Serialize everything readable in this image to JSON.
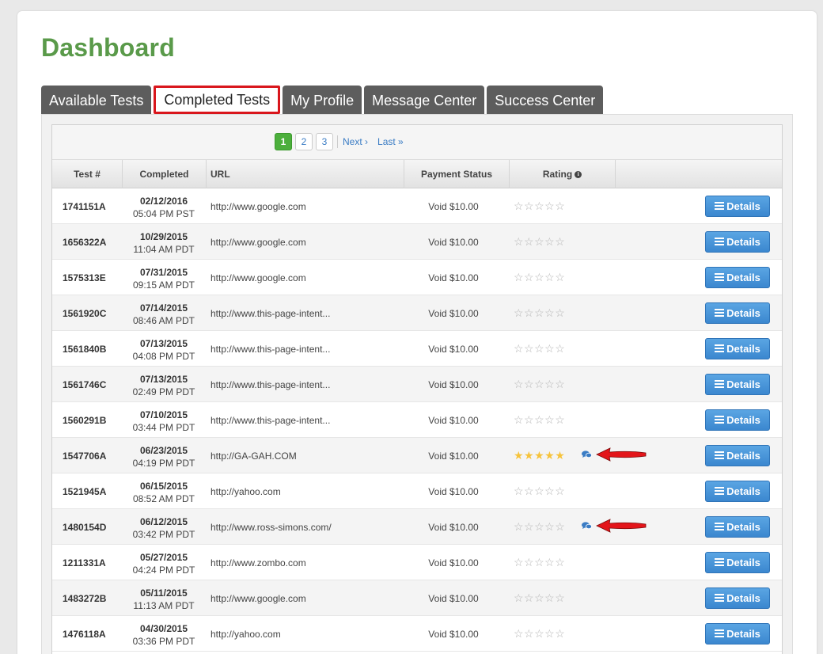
{
  "page_title": "Dashboard",
  "tabs": [
    {
      "label": "Available Tests"
    },
    {
      "label": "Completed Tests"
    },
    {
      "label": "My Profile"
    },
    {
      "label": "Message Center"
    },
    {
      "label": "Success Center"
    }
  ],
  "active_tab": "Completed Tests",
  "pagination": {
    "pages": [
      "1",
      "2",
      "3"
    ],
    "current": "1",
    "next": "Next ›",
    "last": "Last »"
  },
  "columns": {
    "test": "Test #",
    "completed": "Completed",
    "url": "URL",
    "payment": "Payment Status",
    "rating": "Rating"
  },
  "details_label": "Details",
  "rows": [
    {
      "test": "1741151A",
      "date": "02/12/2016",
      "time": "05:04 PM PST",
      "url": "http://www.google.com",
      "payment": "Void $10.00",
      "rating": 0,
      "stars": "☆☆☆☆☆",
      "comment": false
    },
    {
      "test": "1656322A",
      "date": "10/29/2015",
      "time": "11:04 AM PDT",
      "url": "http://www.google.com",
      "payment": "Void $10.00",
      "rating": 0,
      "stars": "☆☆☆☆☆",
      "comment": false
    },
    {
      "test": "1575313E",
      "date": "07/31/2015",
      "time": "09:15 AM PDT",
      "url": "http://www.google.com",
      "payment": "Void $10.00",
      "rating": 0,
      "stars": "☆☆☆☆☆",
      "comment": false
    },
    {
      "test": "1561920C",
      "date": "07/14/2015",
      "time": "08:46 AM PDT",
      "url": "http://www.this-page-intent...",
      "payment": "Void $10.00",
      "rating": 0,
      "stars": "☆☆☆☆☆",
      "comment": false
    },
    {
      "test": "1561840B",
      "date": "07/13/2015",
      "time": "04:08 PM PDT",
      "url": "http://www.this-page-intent...",
      "payment": "Void $10.00",
      "rating": 0,
      "stars": "☆☆☆☆☆",
      "comment": false
    },
    {
      "test": "1561746C",
      "date": "07/13/2015",
      "time": "02:49 PM PDT",
      "url": "http://www.this-page-intent...",
      "payment": "Void $10.00",
      "rating": 0,
      "stars": "☆☆☆☆☆",
      "comment": false
    },
    {
      "test": "1560291B",
      "date": "07/10/2015",
      "time": "03:44 PM PDT",
      "url": "http://www.this-page-intent...",
      "payment": "Void $10.00",
      "rating": 0,
      "stars": "☆☆☆☆☆",
      "comment": false
    },
    {
      "test": "1547706A",
      "date": "06/23/2015",
      "time": "04:19 PM PDT",
      "url": "http://GA-GAH.COM",
      "payment": "Void $10.00",
      "rating": 5,
      "stars": "★★★★★",
      "comment": true
    },
    {
      "test": "1521945A",
      "date": "06/15/2015",
      "time": "08:52 AM PDT",
      "url": "http://yahoo.com",
      "payment": "Void $10.00",
      "rating": 0,
      "stars": "☆☆☆☆☆",
      "comment": false
    },
    {
      "test": "1480154D",
      "date": "06/12/2015",
      "time": "03:42 PM PDT",
      "url": "http://www.ross-simons.com/",
      "payment": "Void $10.00",
      "rating": 0,
      "stars": "☆☆☆☆☆",
      "comment": true
    },
    {
      "test": "1211331A",
      "date": "05/27/2015",
      "time": "04:24 PM PDT",
      "url": "http://www.zombo.com",
      "payment": "Void $10.00",
      "rating": 0,
      "stars": "☆☆☆☆☆",
      "comment": false
    },
    {
      "test": "1483272B",
      "date": "05/11/2015",
      "time": "11:13 AM PDT",
      "url": "http://www.google.com",
      "payment": "Void $10.00",
      "rating": 0,
      "stars": "☆☆☆☆☆",
      "comment": false
    },
    {
      "test": "1476118A",
      "date": "04/30/2015",
      "time": "03:36 PM PDT",
      "url": "http://yahoo.com",
      "payment": "Void $10.00",
      "rating": 0,
      "stars": "☆☆☆☆☆",
      "comment": false
    }
  ],
  "colors": {
    "brand_green": "#5a9a4a",
    "tab_dark": "#5d5d5d",
    "highlight_red": "#d9161c",
    "button_blue": "#3b87cf",
    "star_gold": "#f6c33a",
    "link_blue": "#3a7cc4"
  }
}
